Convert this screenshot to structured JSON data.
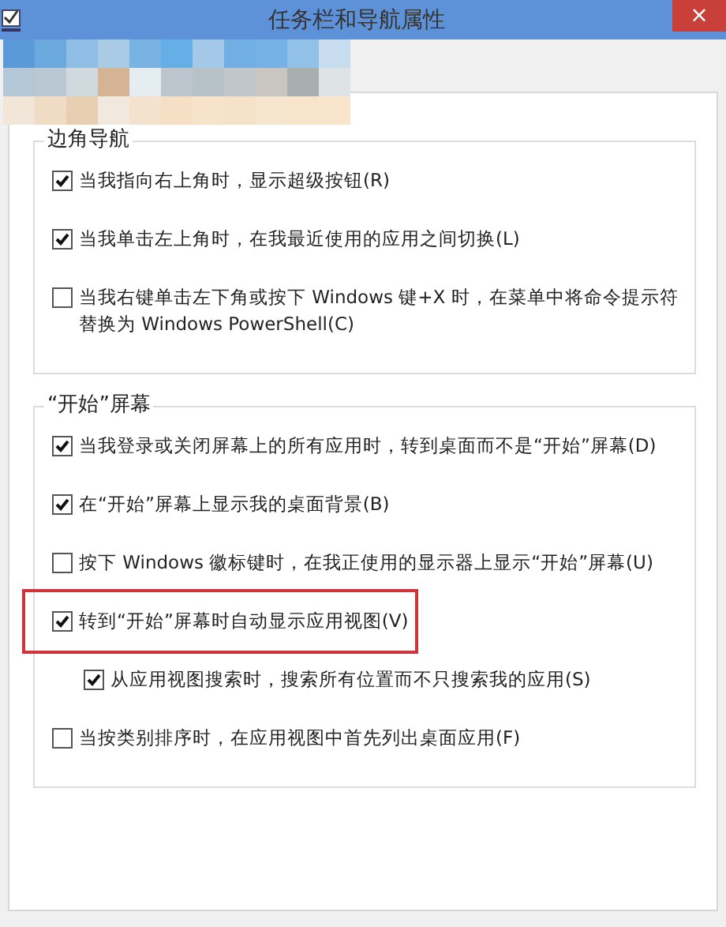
{
  "window": {
    "title": "任务栏和导航属性",
    "close": "×"
  },
  "groups": [
    {
      "title": "边角导航",
      "items": [
        {
          "label": "当我指向右上角时，显示超级按钮(R)",
          "checked": true,
          "highlighted": false
        },
        {
          "label": "当我单击左上角时，在我最近使用的应用之间切换(L)",
          "checked": true,
          "highlighted": false
        },
        {
          "label": "当我右键单击左下角或按下 Windows 键+X 时，在菜单中将命令提示符替换为 Windows PowerShell(C)",
          "checked": false,
          "highlighted": false
        }
      ]
    },
    {
      "title": "“开始”屏幕",
      "items": [
        {
          "label": "当我登录或关闭屏幕上的所有应用时，转到桌面而不是“开始”屏幕(D)",
          "checked": true,
          "highlighted": false
        },
        {
          "label": "在“开始”屏幕上显示我的桌面背景(B)",
          "checked": true,
          "highlighted": false
        },
        {
          "label": "按下 Windows 徽标键时，在我正使用的显示器上显示“开始”屏幕(U)",
          "checked": false,
          "highlighted": false
        },
        {
          "label": "转到“开始”屏幕时自动显示应用视图(V)",
          "checked": true,
          "highlighted": true,
          "children": [
            {
              "label": "从应用视图搜索时，搜索所有位置而不只搜索我的应用(S)",
              "checked": true,
              "highlighted": false
            }
          ]
        },
        {
          "label": "当按类别排序时，在应用视图中首先列出桌面应用(F)",
          "checked": false,
          "highlighted": false
        }
      ]
    }
  ]
}
